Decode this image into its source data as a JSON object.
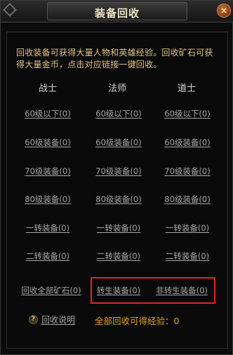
{
  "window": {
    "title": "装备回收",
    "close_glyph": "×"
  },
  "description": "回收装备可获得大量人物和英雄经验。回收矿石可获得大量金币，点击对应链接一键回收。",
  "columns": [
    "战士",
    "法师",
    "道士"
  ],
  "rows": [
    [
      "60级以下(0)",
      "60级以下(0)",
      "60级以下(0)"
    ],
    [
      "60级装备(0)",
      "60级装备(0)",
      "60级装备(0)"
    ],
    [
      "70级装备(0)",
      "70级装备(0)",
      "70级装备(0)"
    ],
    [
      "80级装备(0)",
      "80级装备(0)",
      "80级装备(0)"
    ],
    [
      "一转装备(0)",
      "一转装备(0)",
      "一转装备(0)"
    ],
    [
      "二转装备(0)",
      "二转装备(0)",
      "二转装备(0)"
    ]
  ],
  "bottom_actions": {
    "recycle_all_ore": "回收全部矿石(0)",
    "reborn_equip": "转生装备(0)",
    "non_reborn_equip": "非转生装备(0)"
  },
  "footer": {
    "help_icon_glyph": "?",
    "help_label": "回收说明",
    "exp_text": "全部回收可得经验：0"
  },
  "colors": {
    "highlight": "#e3241f",
    "description": "#e2c58b",
    "exp": "#e6a21f"
  },
  "icons": {
    "close": "close-icon",
    "help": "help-icon",
    "corner": "corner-ornament-icon"
  }
}
